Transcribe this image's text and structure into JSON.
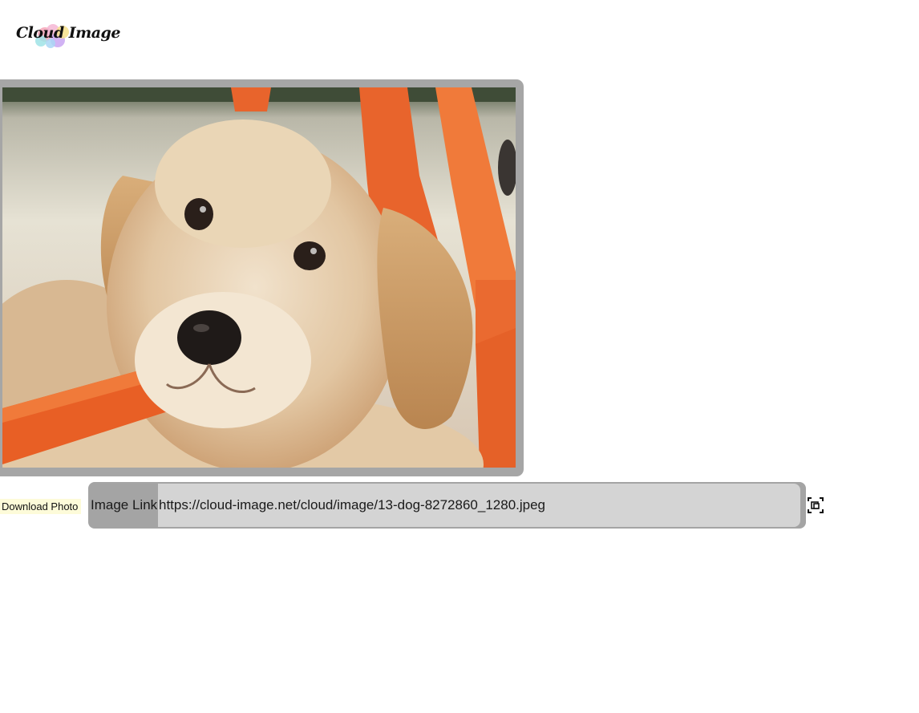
{
  "logo": {
    "text": "Cloud Image",
    "blob_colors": [
      "#f6a6b8",
      "#9fe3e6",
      "#c9a6f2",
      "#f7e08a",
      "#f4b6d4"
    ]
  },
  "photo": {
    "subject": "dog"
  },
  "download": {
    "label": "Download Photo",
    "background": "#fdfbd9"
  },
  "image_link": {
    "label": "Image Link",
    "value": "https://cloud-image.net/cloud/image/13-dog-8272860_1280.jpeg"
  },
  "copy": {
    "icon": "copy-focus-icon"
  },
  "colors": {
    "frame": "#a6a6a6",
    "link_box": "#a4a4a4",
    "link_input": "#d4d4d4"
  }
}
